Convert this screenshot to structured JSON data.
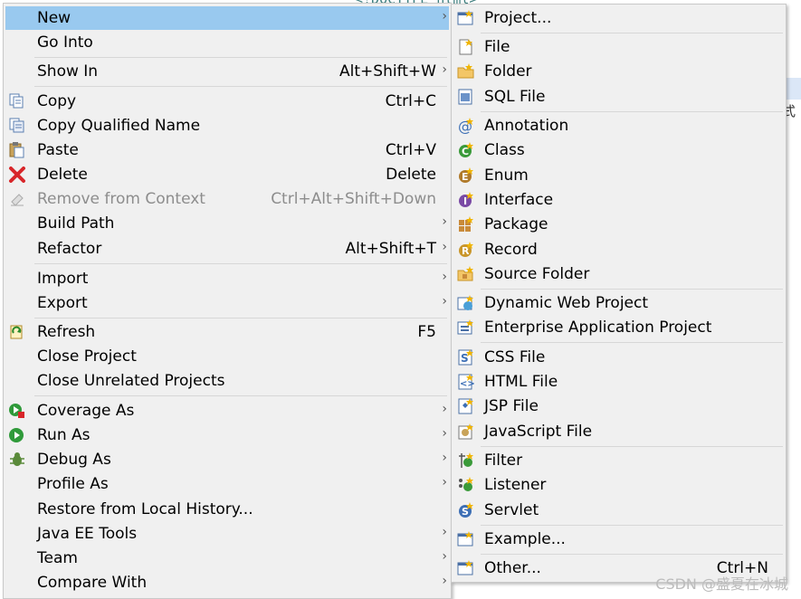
{
  "editor": {
    "code_snippet": "<!DOCTYPE html>",
    "partial_char": "式"
  },
  "menu": {
    "items": [
      {
        "label": "New",
        "accel": "",
        "submenu": true,
        "icon": "",
        "highlighted": true
      },
      {
        "label": "Go Into",
        "accel": "",
        "submenu": false,
        "icon": ""
      },
      {
        "label": "Show In",
        "accel": "Alt+Shift+W",
        "submenu": true,
        "icon": ""
      },
      {
        "label": "Copy",
        "accel": "Ctrl+C",
        "submenu": false,
        "icon": "copy-icon"
      },
      {
        "label": "Copy Qualified Name",
        "accel": "",
        "submenu": false,
        "icon": "copy-qualified-icon"
      },
      {
        "label": "Paste",
        "accel": "Ctrl+V",
        "submenu": false,
        "icon": "paste-icon"
      },
      {
        "label": "Delete",
        "accel": "Delete",
        "submenu": false,
        "icon": "delete-icon"
      },
      {
        "label": "Remove from Context",
        "accel": "Ctrl+Alt+Shift+Down",
        "submenu": false,
        "icon": "remove-context-icon",
        "disabled": true
      },
      {
        "label": "Build Path",
        "accel": "",
        "submenu": true,
        "icon": ""
      },
      {
        "label": "Refactor",
        "accel": "Alt+Shift+T",
        "submenu": true,
        "icon": ""
      },
      {
        "label": "Import",
        "accel": "",
        "submenu": true,
        "icon": ""
      },
      {
        "label": "Export",
        "accel": "",
        "submenu": true,
        "icon": ""
      },
      {
        "label": "Refresh",
        "accel": "F5",
        "submenu": false,
        "icon": "refresh-icon"
      },
      {
        "label": "Close Project",
        "accel": "",
        "submenu": false,
        "icon": ""
      },
      {
        "label": "Close Unrelated Projects",
        "accel": "",
        "submenu": false,
        "icon": ""
      },
      {
        "label": "Coverage As",
        "accel": "",
        "submenu": true,
        "icon": "coverage-icon"
      },
      {
        "label": "Run As",
        "accel": "",
        "submenu": true,
        "icon": "run-icon"
      },
      {
        "label": "Debug As",
        "accel": "",
        "submenu": true,
        "icon": "debug-icon"
      },
      {
        "label": "Profile As",
        "accel": "",
        "submenu": true,
        "icon": ""
      },
      {
        "label": "Restore from Local History...",
        "accel": "",
        "submenu": false,
        "icon": ""
      },
      {
        "label": "Java EE Tools",
        "accel": "",
        "submenu": true,
        "icon": ""
      },
      {
        "label": "Team",
        "accel": "",
        "submenu": true,
        "icon": ""
      },
      {
        "label": "Compare With",
        "accel": "",
        "submenu": true,
        "icon": ""
      }
    ],
    "arrow_glyph": "›"
  },
  "submenu": {
    "items": [
      {
        "label": "Project...",
        "accel": "",
        "icon": "project-icon"
      },
      {
        "label": "File",
        "accel": "",
        "icon": "file-icon"
      },
      {
        "label": "Folder",
        "accel": "",
        "icon": "folder-icon"
      },
      {
        "label": "SQL File",
        "accel": "",
        "icon": "sql-file-icon"
      },
      {
        "label": "Annotation",
        "accel": "",
        "icon": "annotation-icon"
      },
      {
        "label": "Class",
        "accel": "",
        "icon": "class-icon"
      },
      {
        "label": "Enum",
        "accel": "",
        "icon": "enum-icon"
      },
      {
        "label": "Interface",
        "accel": "",
        "icon": "interface-icon"
      },
      {
        "label": "Package",
        "accel": "",
        "icon": "package-icon"
      },
      {
        "label": "Record",
        "accel": "",
        "icon": "record-icon"
      },
      {
        "label": "Source Folder",
        "accel": "",
        "icon": "source-folder-icon"
      },
      {
        "label": "Dynamic Web Project",
        "accel": "",
        "icon": "dynamic-web-project-icon"
      },
      {
        "label": "Enterprise Application Project",
        "accel": "",
        "icon": "enterprise-app-icon"
      },
      {
        "label": "CSS File",
        "accel": "",
        "icon": "css-file-icon"
      },
      {
        "label": "HTML File",
        "accel": "",
        "icon": "html-file-icon"
      },
      {
        "label": "JSP File",
        "accel": "",
        "icon": "jsp-file-icon"
      },
      {
        "label": "JavaScript File",
        "accel": "",
        "icon": "javascript-file-icon"
      },
      {
        "label": "Filter",
        "accel": "",
        "icon": "filter-icon"
      },
      {
        "label": "Listener",
        "accel": "",
        "icon": "listener-icon"
      },
      {
        "label": "Servlet",
        "accel": "",
        "icon": "servlet-icon"
      },
      {
        "label": "Example...",
        "accel": "",
        "icon": "example-icon"
      },
      {
        "label": "Other...",
        "accel": "Ctrl+N",
        "icon": "other-icon"
      }
    ]
  },
  "watermark": "CSDN @盛夏在冰城",
  "colors": {
    "highlight": "#99c9ef",
    "menu_bg": "#f0f0f0",
    "separator": "#d7d7d7",
    "disabled_text": "#8d8d8d"
  }
}
